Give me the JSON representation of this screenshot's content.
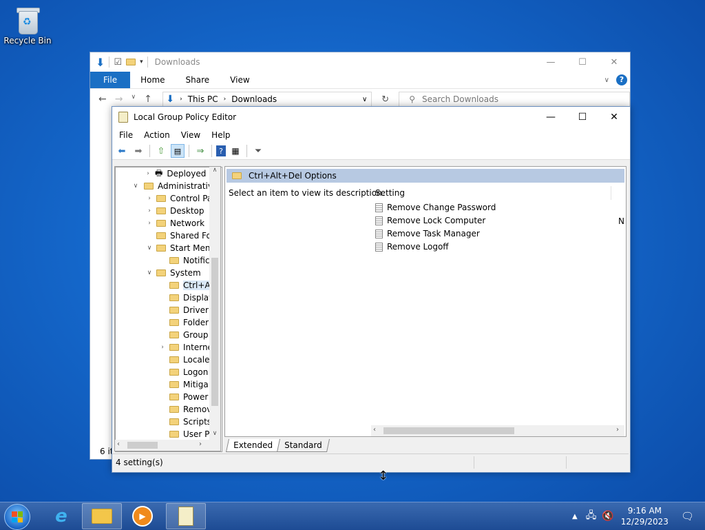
{
  "desktop": {
    "icons": [
      {
        "label": "Recycle Bin"
      }
    ]
  },
  "explorer": {
    "title": "Downloads",
    "ribbon_tabs": [
      "File",
      "Home",
      "Share",
      "View"
    ],
    "address": {
      "crumb1": "This PC",
      "crumb2": "Downloads"
    },
    "search_placeholder": "Search Downloads",
    "status": "6 it"
  },
  "gpe": {
    "title": "Local Group Policy Editor",
    "menu": [
      "File",
      "Action",
      "View",
      "Help"
    ],
    "tree": [
      {
        "label": "Deployed",
        "arrow": ">"
      },
      {
        "label": "Administrative",
        "arrow": "v"
      },
      {
        "label": "Control Pa",
        "arrow": ">"
      },
      {
        "label": "Desktop",
        "arrow": ">"
      },
      {
        "label": "Network",
        "arrow": ">"
      },
      {
        "label": "Shared Fol",
        "arrow": ""
      },
      {
        "label": "Start Menu",
        "arrow": "v"
      },
      {
        "label": "Notific",
        "arrow": ""
      },
      {
        "label": "System",
        "arrow": "v"
      },
      {
        "label": "Ctrl+A",
        "arrow": ""
      },
      {
        "label": "Display",
        "arrow": ""
      },
      {
        "label": "Driver",
        "arrow": ""
      },
      {
        "label": "Folder",
        "arrow": ""
      },
      {
        "label": "Group",
        "arrow": ""
      },
      {
        "label": "Interne",
        "arrow": ">"
      },
      {
        "label": "Locale",
        "arrow": ""
      },
      {
        "label": "Logon",
        "arrow": ""
      },
      {
        "label": "Mitiga",
        "arrow": ""
      },
      {
        "label": "Power",
        "arrow": ""
      },
      {
        "label": "Remov",
        "arrow": ""
      },
      {
        "label": "Scripts",
        "arrow": ""
      },
      {
        "label": "User Pr",
        "arrow": ""
      }
    ],
    "right_header": "Ctrl+Alt+Del Options",
    "description": "Select an item to view its description.",
    "column_setting": "Setting",
    "settings": [
      "Remove Change Password",
      "Remove Lock Computer",
      "Remove Task Manager",
      "Remove Logoff"
    ],
    "extra_col_value": "N",
    "tabs": [
      "Extended",
      "Standard"
    ],
    "status": "4 setting(s)"
  },
  "taskbar": {
    "time": "9:16 AM",
    "date": "12/29/2023"
  }
}
